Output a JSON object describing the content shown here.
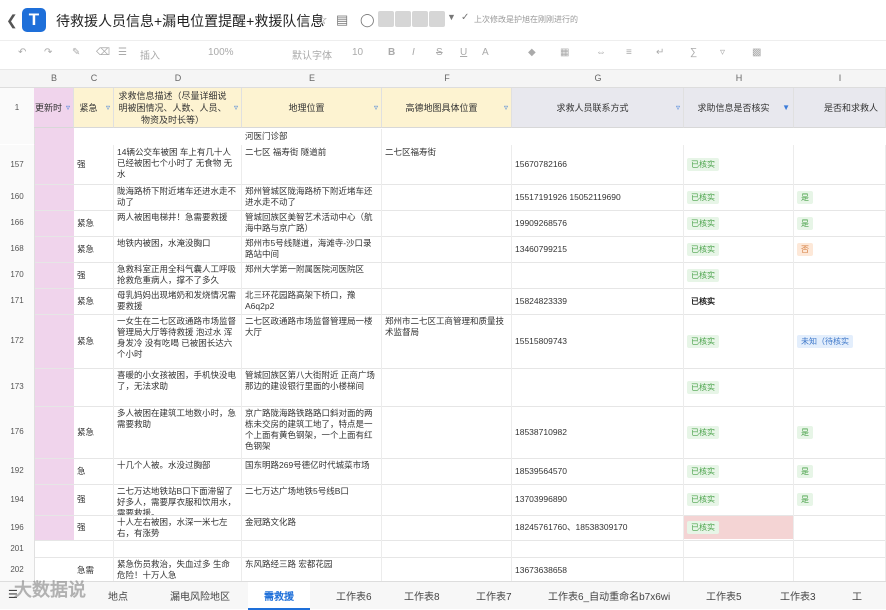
{
  "header": {
    "title": "待救援人员信息+漏电位置提醒+救援队信息",
    "save_status": "上次修改是护旭在刚刚进行的",
    "logo_letter": "T"
  },
  "toolbar": {
    "items": [
      "插入",
      "100%",
      "默认字体",
      "10"
    ]
  },
  "columns": [
    "B",
    "C",
    "D",
    "E",
    "F",
    "G",
    "H",
    "I"
  ],
  "fields": {
    "row_no": "1",
    "b": "更新时",
    "c": "紧急",
    "d": "求救信息描述（尽量详细说明被困情况、人数、人员、物资及时长等）",
    "e": "地理位置",
    "f": "高德地图具体位置",
    "g": "求救人员联系方式",
    "h": "求助信息是否核实",
    "i": "是否和求救人"
  },
  "top_partial": "河医门诊部",
  "rows": [
    {
      "no": "157",
      "c": "强",
      "d": "14辆公交车被困 车上有几十人 已经被困七个小时了 无食物 无水",
      "e": "二七区 福寿街 隧道前",
      "f": "二七区福寿街",
      "g": "15670782166",
      "h": "已核实",
      "i": ""
    },
    {
      "no": "160",
      "c": "",
      "d": "陇海路桥下附近堵车还进水走不动了",
      "e": "郑州管城区陇海路桥下附近堵车还进水走不动了",
      "f": "",
      "g": "15517191926 15052119690",
      "h": "已核实",
      "i": "是"
    },
    {
      "no": "166",
      "c": "紧急",
      "d": "两人被困电梯井！急需要救援",
      "e": "管城回族区美智艺术活动中心（航海中路与京广路）",
      "f": "",
      "g": "19909268576",
      "h": "已核实",
      "i": "是"
    },
    {
      "no": "168",
      "c": "紧急",
      "d": "地铁内被困，水淹没胸口",
      "e": "郑州市5号线隧道，海滩寺-沙口录路站中间",
      "f": "",
      "g": "13460799215",
      "h": "已核实",
      "i": "否"
    },
    {
      "no": "170",
      "c": "强",
      "d": "急救科室正用全科气囊人工呼吸抢救危重病人，撑不了多久",
      "e": "郑州大学第一附属医院河医院区",
      "f": "",
      "g": "",
      "h": "已核实",
      "i": ""
    },
    {
      "no": "171",
      "c": "紧急",
      "d": "母乳妈妈出现堵奶和发烧情况需要救援",
      "e": "北三环花园路高架下桥口，豫A6q2p2",
      "f": "",
      "g": "15824823339",
      "h": "已核实",
      "i": ""
    },
    {
      "no": "172",
      "c": "紧急",
      "d": "一女生在二七区政通路市场监督管理局大厅等待救援 泡过水 浑身发冷 没有吃喝 已被困长达六个小时",
      "e": "二七区政通路市场监督管理局一楼大厅",
      "f": "郑州市二七区工商管理和质量技术监督局",
      "g": "15515809743",
      "h": "已核实",
      "i": "未知（待核实"
    },
    {
      "no": "173",
      "c": "",
      "d": "喜暖的小女孩被困，手机快没电了，无法求助",
      "e": "管城回族区第八大街附近 正商广场那边的建设银行里面的小楼梯间",
      "f": "",
      "g": "",
      "h": "已核实",
      "i": ""
    },
    {
      "no": "176",
      "c": "紧急",
      "d": "多人被困在建筑工地数小时，急需要救助",
      "e": "京广路陇海路铁路路口斜对面的两栋未交房的建筑工地了，特点是一个上面有黄色钢架，一个上面有红色钢架",
      "f": "",
      "g": "18538710982",
      "h": "已核实",
      "i": "是"
    },
    {
      "no": "192",
      "c": "急",
      "d": "十几个人被。水没过胸部",
      "e": "国东明路269号德亿时代城菜市场",
      "f": "",
      "g": "18539564570",
      "h": "已核实",
      "i": "是"
    },
    {
      "no": "194",
      "c": "强",
      "d": "二七万达地铁站B口下面滞留了好多人，需要厚衣服和饮用水，需要救援。",
      "e": "二七万达广场地铁5号线B口",
      "f": "",
      "g": "13703996890",
      "h": "已核实",
      "i": "是"
    },
    {
      "no": "196",
      "c": "强",
      "d": "十人左右被困，水深一米七左右，有涨势",
      "e": "金冠路文化路",
      "f": "",
      "g": "18245761760、18538309170",
      "h": "已核实",
      "i": ""
    },
    {
      "no": "201",
      "c": "",
      "d": "",
      "e": "",
      "f": "",
      "g": "",
      "h": "",
      "i": ""
    },
    {
      "no": "202",
      "c": "急需",
      "d": "紧急伤员救治，失血过多 生命危险！十万人急",
      "e": "东风路经三路 宏都花园",
      "f": "",
      "g": "13673638658",
      "h": "",
      "i": ""
    }
  ],
  "sheet_tabs": [
    "地点",
    "漏电风险地区",
    "需救援",
    "工作表6",
    "工作表8",
    "工作表7",
    "工作表6_自动重命名b7x6wi",
    "工作表5",
    "工作表3",
    "工"
  ],
  "active_tab": "需救援",
  "watermark": "大数据说",
  "colors": {
    "accent": "#1e6fd9",
    "header_yellow": "#fdf3d1",
    "header_gray": "#e8e8ee",
    "col_b_pink": "#f0d4ec",
    "ok_green": "#4aa24a",
    "flag_red": "#f4d4d4"
  }
}
